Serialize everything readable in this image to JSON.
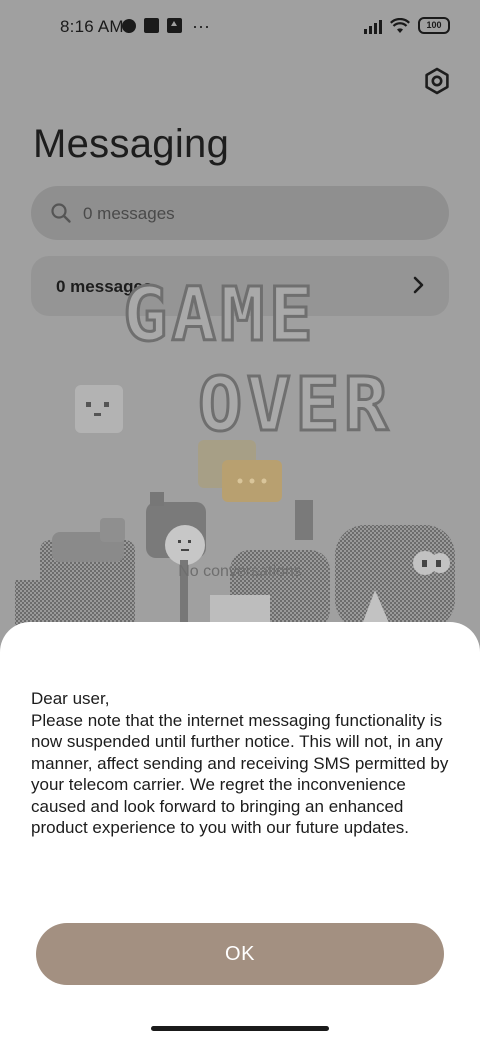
{
  "status_bar": {
    "time": "8:16 AM",
    "battery": "100"
  },
  "header": {
    "title": "Messaging"
  },
  "search": {
    "placeholder": "0 messages"
  },
  "messages_row": {
    "label": "0 messages"
  },
  "illustration": {
    "headline_line1": "GAME",
    "headline_line2": "OVER",
    "empty_text": "No conversations"
  },
  "dialog": {
    "greeting": "Dear user,",
    "body": "Please note that the internet messaging functionality is now suspended until further notice. This will not, in any manner, affect sending and receiving SMS permitted by your telecom carrier. We regret the inconvenience caused and look forward to bringing an enhanced product experience to you with our future updates.",
    "ok_label": "OK"
  },
  "colors": {
    "accent_button": "#a39081",
    "sheet_bg": "#ffffff",
    "dimmed_bg": "#a0a0a0"
  },
  "icons": {
    "settings": "settings-icon",
    "search": "search-icon",
    "chevron": "chevron-right-icon"
  }
}
